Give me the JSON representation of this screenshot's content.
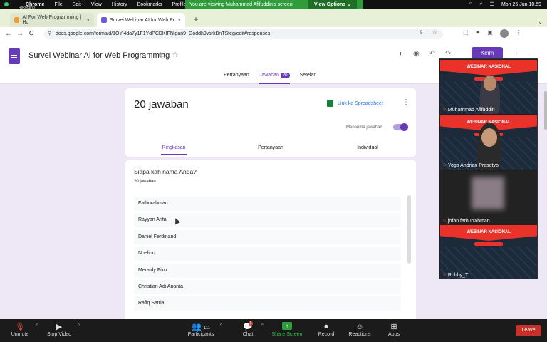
{
  "menubar": {
    "recording_label": "Recording",
    "app": "Chrome",
    "menus": [
      "File",
      "Edit",
      "View",
      "History",
      "Bookmarks",
      "Profiles"
    ],
    "share_banner": "You are viewing Muhammad Afifuddin's screen",
    "view_options": "View Options",
    "datetime": "Mon 26 Jun 10.59"
  },
  "browser": {
    "tabs": [
      {
        "title": "AI For Web Programming | Ho"
      },
      {
        "title": "Survei Webinar AI for Web Pr"
      }
    ],
    "url": "docs.google.com/forms/d/1OYi4da7y1F1YdPCDKIFNjgan9_Goddh9vsrkBnTSfeg/edit#responses"
  },
  "form": {
    "title": "Survei Webinar AI for Web Programming",
    "send_label": "Kirim",
    "tabs": {
      "questions": "Pertanyaan",
      "responses": "Jawaban",
      "responses_count": "20",
      "settings": "Setelan"
    },
    "summary": {
      "count_text": "20 jawaban",
      "sheet_link": "Link ke Spreadsheet",
      "accepting_label": "Menerima jawaban",
      "sub_tabs": [
        "Ringkasan",
        "Pertanyaan",
        "Individual"
      ]
    },
    "question": {
      "title": "Siapa kah nama Anda?",
      "count": "20 jawaban",
      "answers": [
        "Fathurahman",
        "Rayyan Arifa",
        "Daniel Ferdinand",
        "Noelino",
        "Meraldy Fiko",
        "Christian Adi Ananta",
        "Rafiq Satria"
      ]
    }
  },
  "video_panel": {
    "participants": [
      {
        "name": "Muhammad Afifuddin",
        "banner": "WEBINAR NASIONAL",
        "muted": true
      },
      {
        "name": "Yoga Andrian Prasetyo",
        "banner": "WEBINAR NASIONAL",
        "muted": true
      },
      {
        "name": "jofan fathurrahman",
        "muted": true
      },
      {
        "name": "Robby_TI",
        "banner": "WEBINAR NASIONAL",
        "muted": true
      }
    ]
  },
  "zoom_toolbar": {
    "unmute": "Unmute",
    "stop_video": "Stop Video",
    "participants": "Participants",
    "participants_count": "111",
    "chat": "Chat",
    "chat_badge": "1",
    "share_screen": "Share Screen",
    "record": "Record",
    "reactions": "Reactions",
    "apps": "Apps",
    "leave": "Leave"
  },
  "colors": {
    "accent": "#673ab7",
    "content_bg": "#ede7f6",
    "share_green": "#2f9b3a",
    "leave_red": "#c7312b"
  }
}
